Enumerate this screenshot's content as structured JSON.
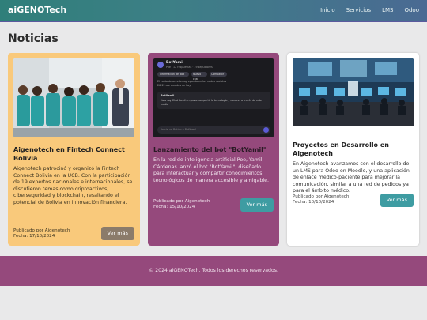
{
  "header": {
    "brand": "aiGENOTech",
    "nav": [
      "Inicio",
      "Servicios",
      "LMS",
      "Odoo"
    ]
  },
  "page_title": "Noticias",
  "cards": [
    {
      "title": "Aigenotech en Fintech Connect Bolivia",
      "text": "Aigenotech patrocinó y organizó la Fintech Connect Bolivia en la UCB. Con la participación de 19 expertos nacionales e internacionales, se discutieron temas como criptoactivos, ciberseguridad y blockchain, resaltando el potencial de Bolivia en innovación financiera.",
      "author": "Publicado por Aigenotech",
      "date": "Fecha: 17/10/2024",
      "button": "Ver más"
    },
    {
      "title": "Lanzamiento del bot \"BotYamil\"",
      "text": "En la red de inteligencia artificial Poe, Yamil Cárdenas lanzó el bot \"BotYamil\", diseñado para interactuar y compartir conocimientos tecnológicos de manera accesible y amigable.",
      "author": "Publicado por Aigenotech",
      "date": "Fecha: 15/10/2024",
      "button": "Ver más",
      "screenshot": {
        "bot_name": "BotYamil",
        "bot_handle": "Poe · 12 respuestas · 19 seguidores",
        "chip_1": "Información del bot",
        "chip_2": "Nuevo chat",
        "chip_3": "Compartir",
        "desc_line_1": "El costo de acceder agregando en los nodos sociales",
        "desc_line_2": "20-12 are creadas de hoy",
        "reply_name": "BotYamil",
        "reply_line_1": "Hola soy Chat Yamil en gusto compartir la tecnología y conocer a través de este",
        "reply_line_2": "medio",
        "input_placeholder": "Inicia un Botián o BotYamil"
      }
    },
    {
      "title": "Proyectos en Desarrollo en Aigenotech",
      "text": "En Aigenotech avanzamos con el desarrollo de un LMS para Odoo en Moodle, y una aplicación de enlace médico-paciente para mejorar la comunicación, similar a una red de pedidos ya para el ámbito médico.",
      "author": "Publicado por Aigenotech",
      "date": "Fecha: 10/10/2024",
      "button": "Ver más"
    }
  ],
  "footer": "© 2024 aiGENOTech. Todos los derechos reservados."
}
